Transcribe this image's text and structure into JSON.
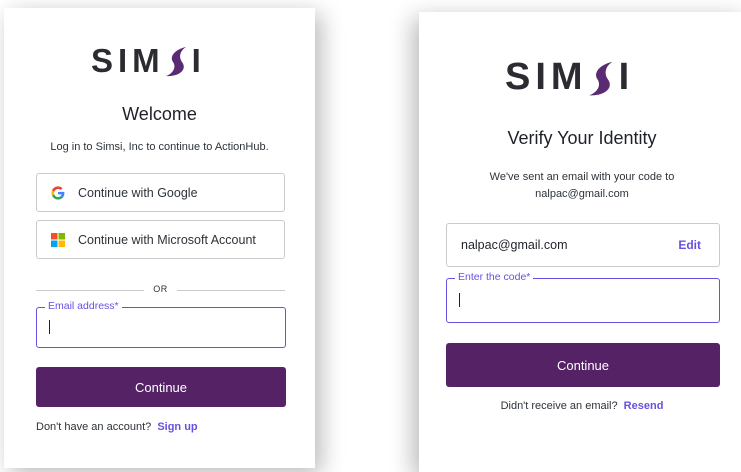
{
  "brand": {
    "logo_text": "SIM",
    "logo_suffix": "I"
  },
  "login": {
    "title": "Welcome",
    "subtitle": "Log in to Simsi, Inc to continue to ActionHub.",
    "google_label": "Continue with Google",
    "microsoft_label": "Continue with Microsoft Account",
    "divider_text": "OR",
    "email_label": "Email address*",
    "continue_label": "Continue",
    "footer_text": "Don't have an account?",
    "signup_label": "Sign up"
  },
  "verify": {
    "title": "Verify Your Identity",
    "subtitle_line1": "We've sent an email with your code to",
    "subtitle_line2": "nalpac@gmail.com",
    "email_value": "nalpac@gmail.com",
    "edit_label": "Edit",
    "code_label": "Enter the code*",
    "continue_label": "Continue",
    "footer_text": "Didn't receive an email?",
    "resend_label": "Resend"
  },
  "colors": {
    "primary": "#552266",
    "accent": "#6a4fe0",
    "logo_swoosh": "#5b2a74"
  }
}
